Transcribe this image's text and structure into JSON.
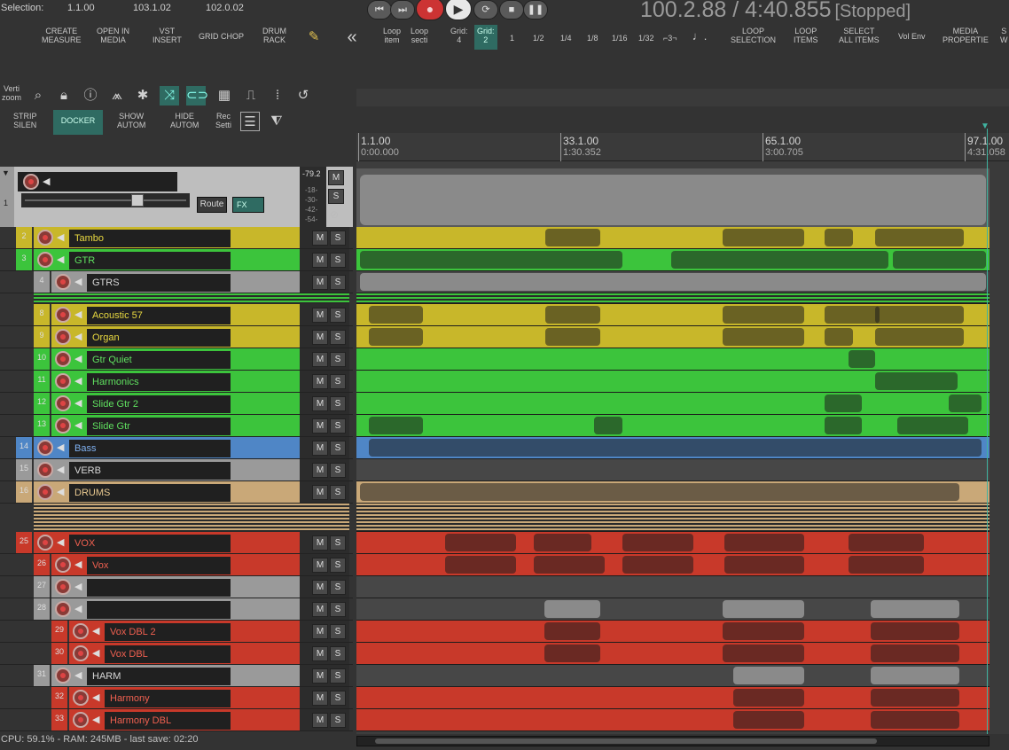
{
  "selection": {
    "label": "Selection:",
    "start": "1.1.00",
    "end": "103.1.02",
    "length": "102.0.02"
  },
  "transport": {
    "buttons": [
      {
        "name": "go-to-start",
        "glyph": "⏮"
      },
      {
        "name": "go-to-end",
        "glyph": "⏭"
      },
      {
        "name": "record",
        "glyph": "●"
      },
      {
        "name": "play",
        "glyph": "▶"
      },
      {
        "name": "repeat",
        "glyph": "⟳"
      },
      {
        "name": "stop",
        "glyph": "■"
      },
      {
        "name": "pause",
        "glyph": "❚❚"
      }
    ],
    "time": "100.2.88 / 4:40.855",
    "state": "[Stopped]"
  },
  "toolbar": {
    "create_measure": "CREATE\nMEASURE",
    "open_in_media": "OPEN IN\nMEDIA",
    "vst_insert": "VST\nINSERT",
    "grid_chop": "GRID CHOP",
    "drum_rack": "DRUM\nRACK",
    "loop_item": "Loop\nitem",
    "loop_sect": "Loop\nsecti",
    "grid4": "Grid:\n4",
    "grid2": "Grid:\n2",
    "div": [
      "1",
      "1/2",
      "1/4",
      "1/8",
      "1/16",
      "1/32",
      "⌐3¬"
    ],
    "loop_selection": "LOOP\nSELECTION",
    "loop_items": "LOOP\nITEMS",
    "select_all": "SELECT\nALL ITEMS",
    "vol_env": "Vol Env",
    "media_props": "MEDIA\nPROPERTIE",
    "extra": "S\nW"
  },
  "left_toolbar": {
    "vert_zoom": "Verti\nzoom",
    "strip_silence": "STRIP\nSILEN",
    "docker": "DOCKER",
    "show_autom": "SHOW\nAUTOM",
    "hide_autom": "HIDE\nAUTOM",
    "rec_settings": "Rec\nSetti"
  },
  "ruler": [
    {
      "bar": "1.1.00",
      "time": "0:00.000"
    },
    {
      "bar": "33.1.00",
      "time": "1:30.352"
    },
    {
      "bar": "65.1.00",
      "time": "3:00.705"
    },
    {
      "bar": "97.1.00",
      "time": "4:31.058"
    }
  ],
  "master": {
    "num": "1",
    "db": "-79.2",
    "scale": [
      "-18-",
      "-30-",
      "-42-",
      "-54-"
    ],
    "route": "Route",
    "fx": "FX",
    "mute": "M",
    "solo": "S"
  },
  "tracks": [
    {
      "num": "2",
      "name": "Tambo",
      "color": "#c8b72a",
      "text": "#e8d840",
      "indent": 0
    },
    {
      "num": "3",
      "name": "GTR",
      "color": "#3cc43c",
      "text": "#5fe05f",
      "indent": 0
    },
    {
      "num": "4",
      "name": "GTRS",
      "color": "#9a9a9a",
      "text": "#d8d8d8",
      "indent": 1
    },
    {
      "num": "8",
      "name": "Acoustic 57",
      "color": "#c8b72a",
      "text": "#e8d840",
      "indent": 1
    },
    {
      "num": "9",
      "name": "Organ",
      "color": "#c8b72a",
      "text": "#e8d840",
      "indent": 1
    },
    {
      "num": "10",
      "name": "Gtr Quiet",
      "color": "#3cc43c",
      "text": "#5fe05f",
      "indent": 1
    },
    {
      "num": "11",
      "name": "Harmonics",
      "color": "#3cc43c",
      "text": "#5fe05f",
      "indent": 1
    },
    {
      "num": "12",
      "name": "Slide Gtr 2",
      "color": "#3cc43c",
      "text": "#5fe05f",
      "indent": 1
    },
    {
      "num": "13",
      "name": "Slide Gtr",
      "color": "#3cc43c",
      "text": "#5fe05f",
      "indent": 1
    },
    {
      "num": "14",
      "name": "Bass",
      "color": "#4f86c6",
      "text": "#7fb0f0",
      "indent": 0
    },
    {
      "num": "15",
      "name": "VERB",
      "color": "#9a9a9a",
      "text": "#d8d8d8",
      "indent": 0
    },
    {
      "num": "16",
      "name": "DRUMS",
      "color": "#c9a878",
      "text": "#e8c890",
      "indent": 0
    },
    {
      "num": "25",
      "name": "VOX",
      "color": "#c8392a",
      "text": "#f06050",
      "indent": 0
    },
    {
      "num": "26",
      "name": "Vox",
      "color": "#c8392a",
      "text": "#f06050",
      "indent": 1
    },
    {
      "num": "27",
      "name": "",
      "color": "#9a9a9a",
      "text": "#d8d8d8",
      "indent": 1
    },
    {
      "num": "28",
      "name": "",
      "color": "#9a9a9a",
      "text": "#d8d8d8",
      "indent": 1
    },
    {
      "num": "29",
      "name": "Vox DBL 2",
      "color": "#c8392a",
      "text": "#f06050",
      "indent": 2
    },
    {
      "num": "30",
      "name": "Vox DBL",
      "color": "#c8392a",
      "text": "#f06050",
      "indent": 2
    },
    {
      "num": "31",
      "name": "HARM",
      "color": "#9a9a9a",
      "text": "#d8d8d8",
      "indent": 1
    },
    {
      "num": "32",
      "name": "Harmony",
      "color": "#c8392a",
      "text": "#f06050",
      "indent": 2
    },
    {
      "num": "33",
      "name": "Harmony DBL",
      "color": "#c8392a",
      "text": "#f06050",
      "indent": 2
    }
  ],
  "track_buttons": {
    "mute": "M",
    "solo": "S"
  },
  "status": "CPU: 59.1% - RAM: 245MB - last save: 02:20"
}
